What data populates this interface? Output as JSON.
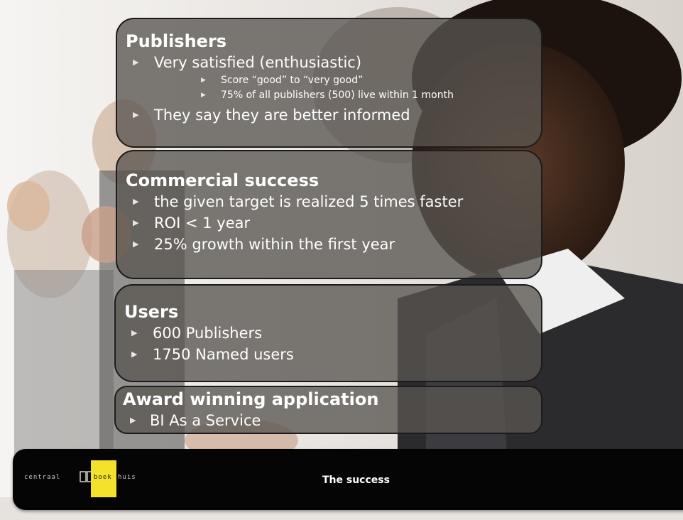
{
  "sections": {
    "publishers": {
      "title": "Publishers",
      "bullet1": "Very satisfied (enthusiastic)",
      "sub1": "Score “good” to “very good”",
      "sub2": "75% of all publishers (500) live within 1 month",
      "bullet2": "They say they are better informed"
    },
    "commercial": {
      "title": "Commercial success",
      "bullets": [
        "the given target is realized 5 times faster",
        "ROI < 1 year",
        "25% growth within the first year"
      ]
    },
    "users": {
      "title": "Users",
      "bullets": [
        "600 Publishers",
        "1750 Named users"
      ]
    },
    "award": {
      "title": "Award winning application",
      "bullets": [
        "BI As a Service"
      ]
    }
  },
  "footer": {
    "title": "The success",
    "logo_text_left": "centraal",
    "logo_text_yellow": "boek",
    "logo_text_right": "huis"
  },
  "colors": {
    "panel": "#58544f",
    "footer": "#050505",
    "logo_yellow": "#f4e22a"
  },
  "icons": {
    "bullet": "triangle-right-icon"
  }
}
